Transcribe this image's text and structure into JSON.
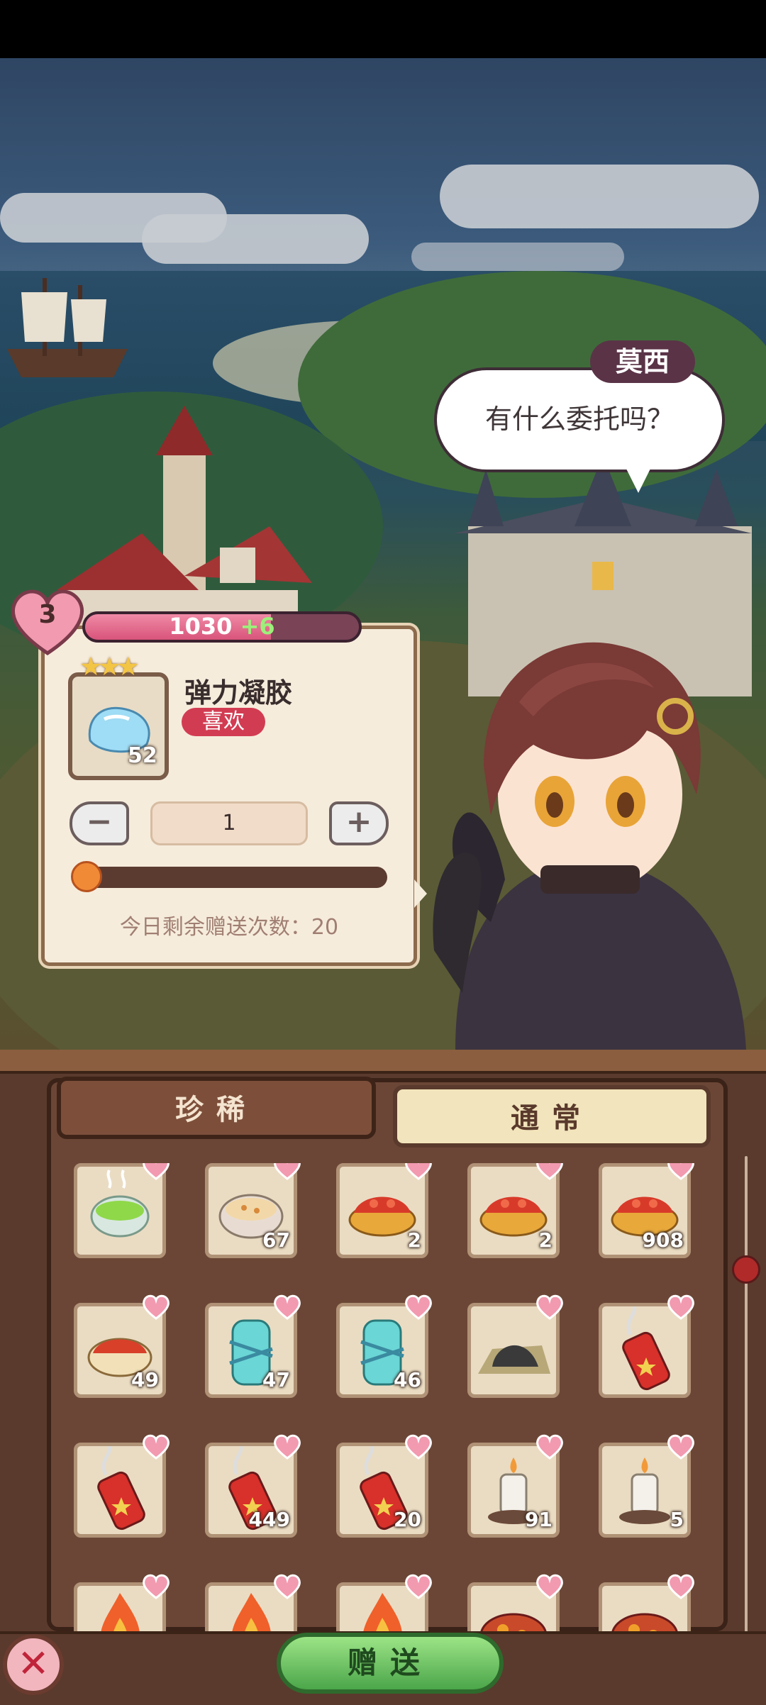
{
  "dialog": {
    "speaker": "莫西",
    "text": "有什么委托吗？"
  },
  "affinity": {
    "level": "3",
    "points": "1030",
    "gain": "+6",
    "progress_fraction": 0.68
  },
  "selected_item": {
    "name": "弹力凝胶",
    "tag": "喜欢",
    "stars": 3,
    "count": "52"
  },
  "quantity": {
    "minus_label": "−",
    "plus_label": "+",
    "value": "1",
    "slider_fraction": 0.0
  },
  "remaining_gifts": "今日剩余赠送次数：20",
  "tabs": [
    {
      "label": "珍稀",
      "active": true
    },
    {
      "label": "通常",
      "active": false
    }
  ],
  "inventory": [
    {
      "icon": "green-soup-icon",
      "count": ""
    },
    {
      "icon": "porridge-bowl-icon",
      "count": "67"
    },
    {
      "icon": "tomato-tart-icon",
      "count": "2"
    },
    {
      "icon": "tomato-tart-icon",
      "count": "2"
    },
    {
      "icon": "tomato-tart-icon",
      "count": "908"
    },
    {
      "icon": "tomato-bowl-icon",
      "count": "49"
    },
    {
      "icon": "chain-jar-icon",
      "count": "47"
    },
    {
      "icon": "chain-jar-icon",
      "count": "46"
    },
    {
      "icon": "coal-pile-icon",
      "count": ""
    },
    {
      "icon": "firework-icon",
      "count": ""
    },
    {
      "icon": "firework-icon",
      "count": ""
    },
    {
      "icon": "firework-icon",
      "count": "449"
    },
    {
      "icon": "firework-icon",
      "count": "20"
    },
    {
      "icon": "candle-icon",
      "count": "91"
    },
    {
      "icon": "candle-icon",
      "count": "5"
    },
    {
      "icon": "fire-icon",
      "count": ""
    },
    {
      "icon": "fire-icon",
      "count": ""
    },
    {
      "icon": "fire-icon",
      "count": ""
    },
    {
      "icon": "lava-dish-icon",
      "count": ""
    },
    {
      "icon": "lava-dish-icon",
      "count": ""
    }
  ],
  "buttons": {
    "close": "✕",
    "give": "赠送"
  },
  "colors": {
    "accent_pink": "#d8547a",
    "like_red": "#d23c52",
    "give_green": "#4ba64a",
    "panel_brown": "#5a3a2c"
  }
}
